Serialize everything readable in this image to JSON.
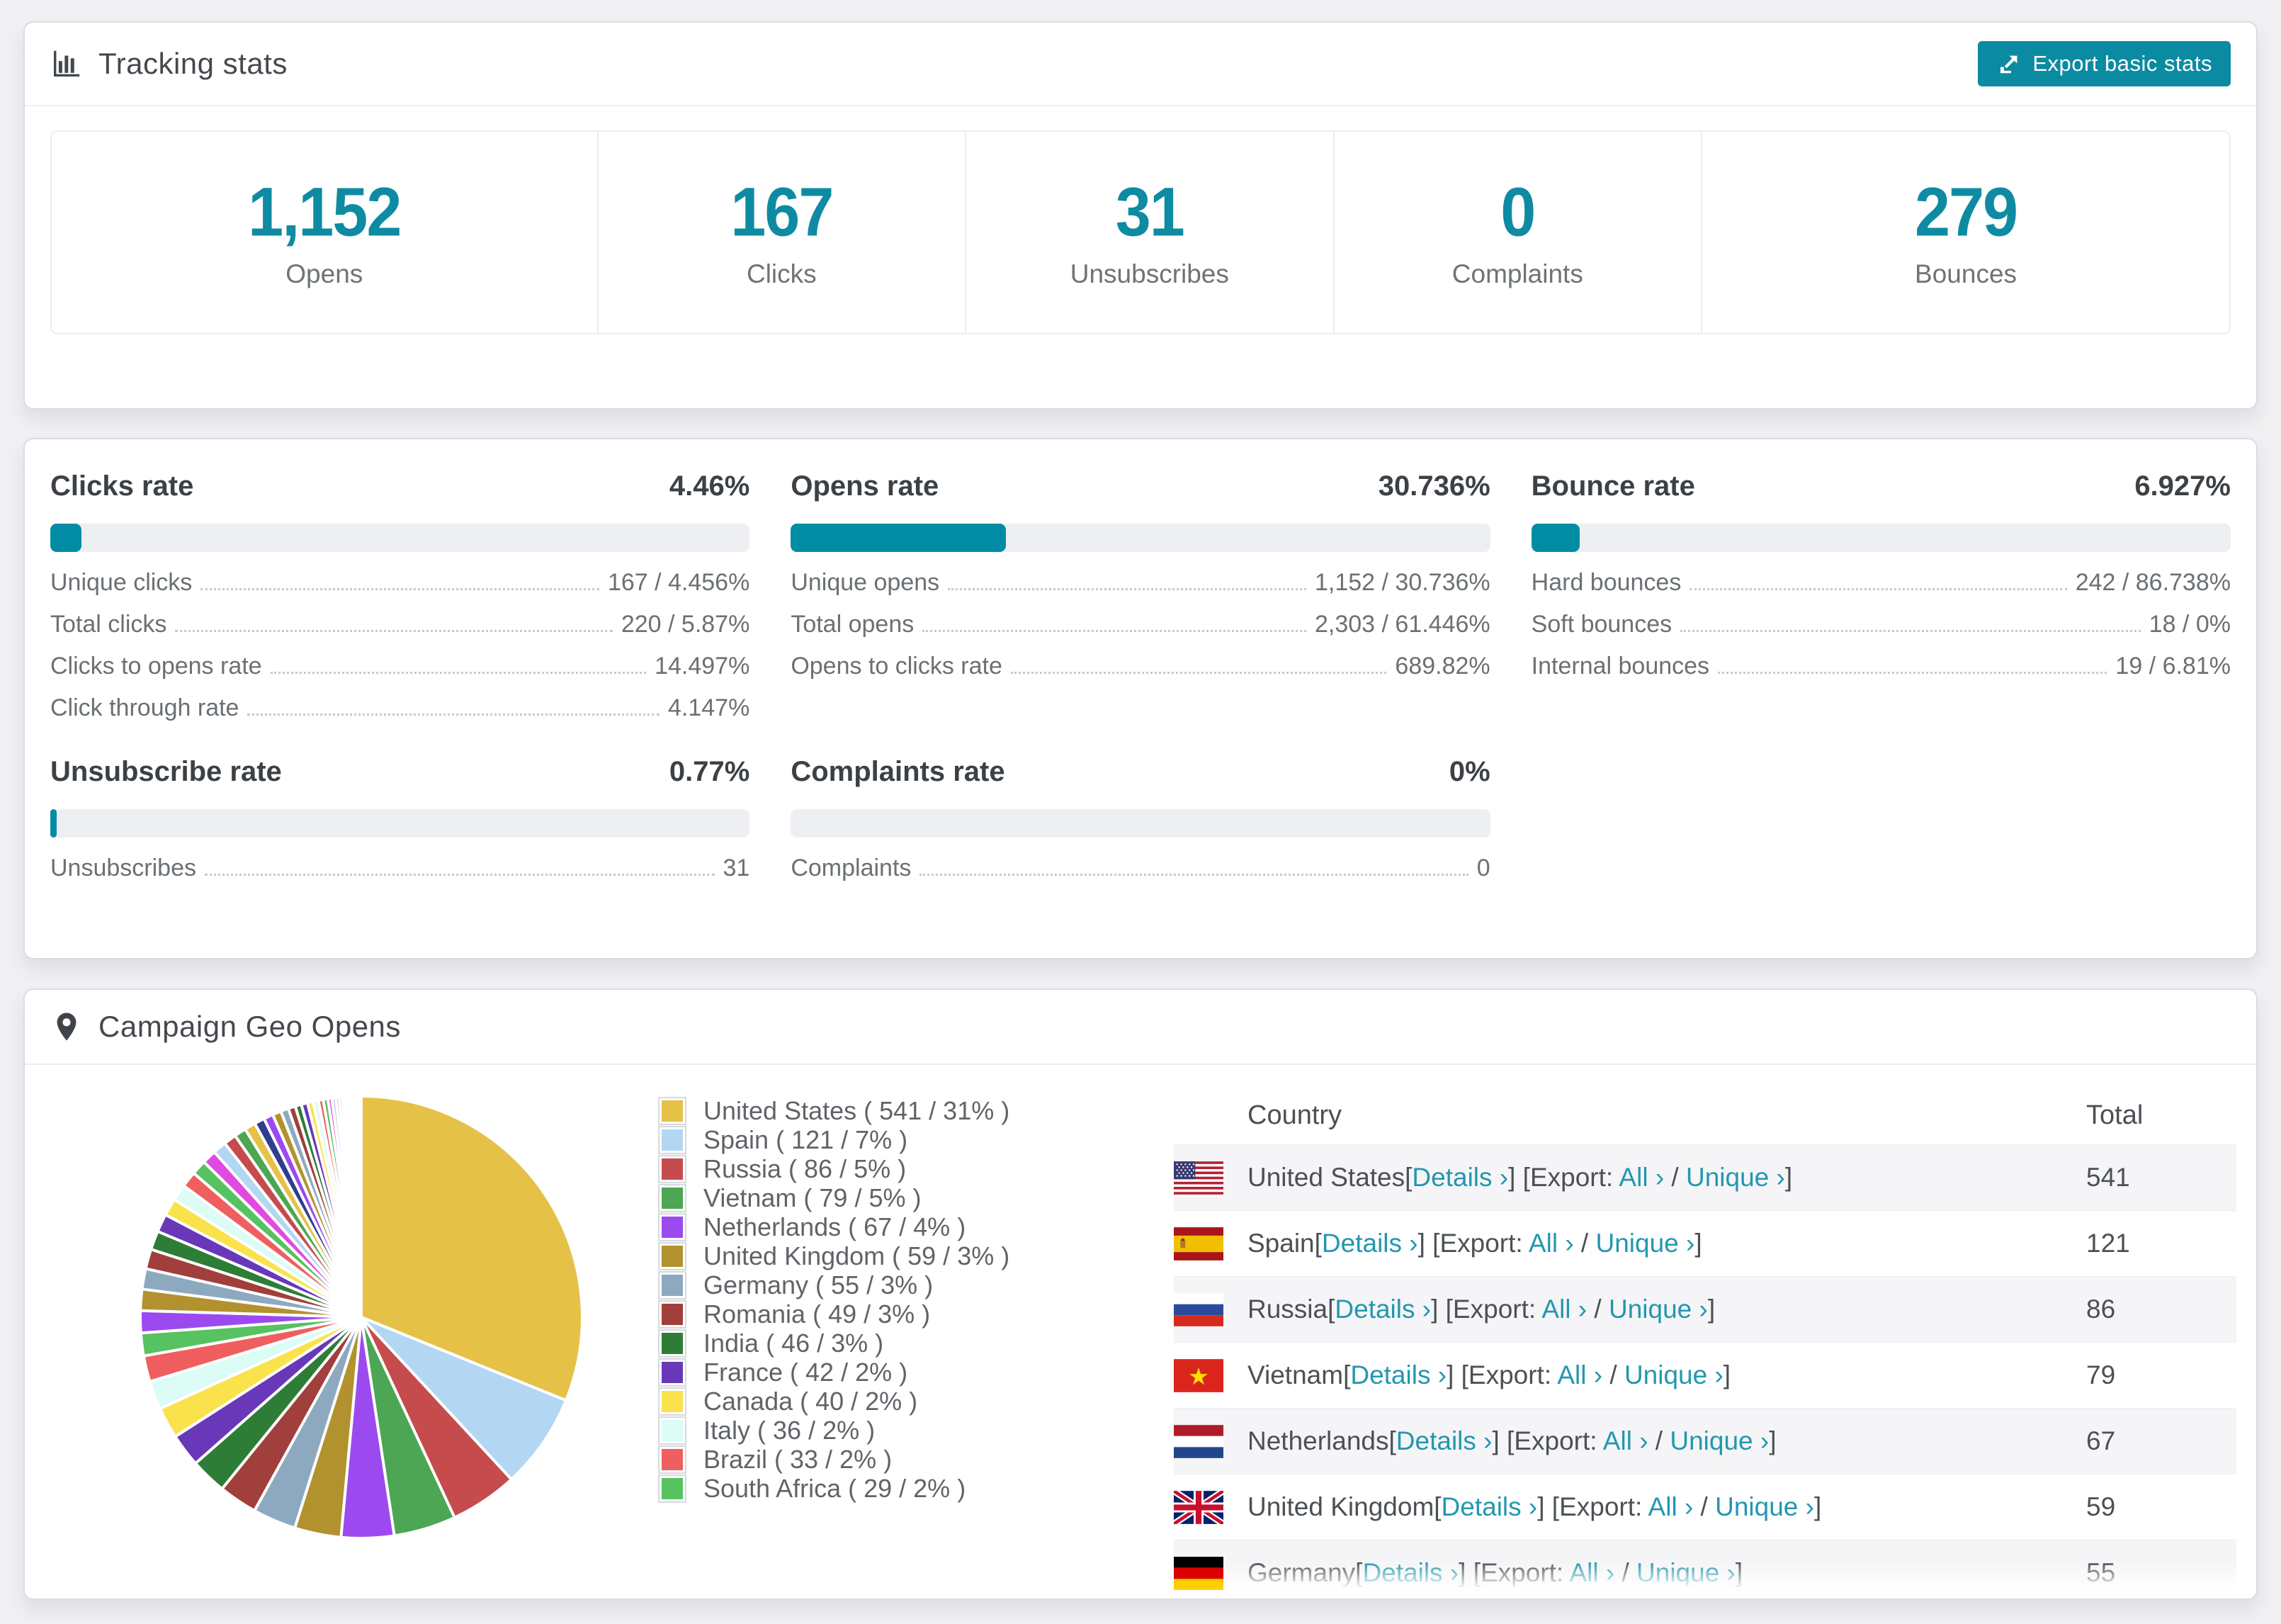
{
  "accent": {
    "teal": "#0b8ba2",
    "teal_link": "#2397af",
    "bar_fill": "#028ca4"
  },
  "tracking": {
    "title": "Tracking stats",
    "export_button": "Export basic stats",
    "stats": [
      {
        "value": "1,152",
        "label": "Opens"
      },
      {
        "value": "167",
        "label": "Clicks"
      },
      {
        "value": "31",
        "label": "Unsubscribes"
      },
      {
        "value": "0",
        "label": "Complaints"
      },
      {
        "value": "279",
        "label": "Bounces"
      }
    ]
  },
  "rates": {
    "blocks": [
      {
        "title": "Clicks rate",
        "value": "4.46%",
        "percent": 4.46,
        "rows": [
          {
            "label": "Unique clicks",
            "value": "167 / 4.456%"
          },
          {
            "label": "Total clicks",
            "value": "220 / 5.87%"
          },
          {
            "label": "Clicks to opens rate",
            "value": "14.497%"
          },
          {
            "label": "Click through rate",
            "value": "4.147%"
          }
        ]
      },
      {
        "title": "Opens rate",
        "value": "30.736%",
        "percent": 30.736,
        "rows": [
          {
            "label": "Unique opens",
            "value": "1,152 / 30.736%"
          },
          {
            "label": "Total opens",
            "value": "2,303 / 61.446%"
          },
          {
            "label": "Opens to clicks rate",
            "value": "689.82%"
          }
        ]
      },
      {
        "title": "Bounce rate",
        "value": "6.927%",
        "percent": 6.927,
        "rows": [
          {
            "label": "Hard bounces",
            "value": "242 / 86.738%"
          },
          {
            "label": "Soft bounces",
            "value": "18 / 0%"
          },
          {
            "label": "Internal bounces",
            "value": "19 / 6.81%"
          }
        ]
      },
      {
        "title": "Unsubscribe rate",
        "value": "0.77%",
        "percent": 0.77,
        "rows": [
          {
            "label": "Unsubscribes",
            "value": "31"
          }
        ]
      },
      {
        "title": "Complaints rate",
        "value": "0%",
        "percent": 0,
        "rows": [
          {
            "label": "Complaints",
            "value": "0"
          }
        ]
      }
    ]
  },
  "geo": {
    "title": "Campaign Geo Opens",
    "table": {
      "columns": [
        "Country",
        "Total"
      ],
      "labels": {
        "details": "Details ›",
        "export": "Export:",
        "all": "All ›",
        "unique": "Unique ›",
        "lb": "[",
        "rb": "]",
        "slash": "/"
      },
      "rows": [
        {
          "country": "United States",
          "flag": "us",
          "total": "541"
        },
        {
          "country": "Spain",
          "flag": "es",
          "total": "121"
        },
        {
          "country": "Russia",
          "flag": "ru",
          "total": "86"
        },
        {
          "country": "Vietnam",
          "flag": "vn",
          "total": "79"
        },
        {
          "country": "Netherlands",
          "flag": "nl",
          "total": "67"
        },
        {
          "country": "United Kingdom",
          "flag": "gb",
          "total": "59"
        },
        {
          "country": "Germany",
          "flag": "de",
          "total": "55"
        }
      ]
    }
  },
  "chart_data": {
    "type": "pie",
    "title": "Campaign Geo Opens",
    "legend_position": "right",
    "slices": [
      {
        "label": "United States",
        "value": 541,
        "pct": "31%",
        "color": "#e5c148"
      },
      {
        "label": "Spain",
        "value": 121,
        "pct": "7%",
        "color": "#b3d6f2"
      },
      {
        "label": "Russia",
        "value": 86,
        "pct": "5%",
        "color": "#c64b4d"
      },
      {
        "label": "Vietnam",
        "value": 79,
        "pct": "5%",
        "color": "#4ca653"
      },
      {
        "label": "Netherlands",
        "value": 67,
        "pct": "4%",
        "color": "#9b4af0"
      },
      {
        "label": "United Kingdom",
        "value": 59,
        "pct": "3%",
        "color": "#b2922f"
      },
      {
        "label": "Germany",
        "value": 55,
        "pct": "3%",
        "color": "#8ca9c0"
      },
      {
        "label": "Romania",
        "value": 49,
        "pct": "3%",
        "color": "#a03f3b"
      },
      {
        "label": "India",
        "value": 46,
        "pct": "3%",
        "color": "#2e7d36"
      },
      {
        "label": "France",
        "value": 42,
        "pct": "2%",
        "color": "#6838b8"
      },
      {
        "label": "Canada",
        "value": 40,
        "pct": "2%",
        "color": "#fae24c"
      },
      {
        "label": "Italy",
        "value": 36,
        "pct": "2%",
        "color": "#dcfcf6"
      },
      {
        "label": "Brazil",
        "value": 33,
        "pct": "2%",
        "color": "#f05f5f"
      },
      {
        "label": "South Africa",
        "value": 29,
        "pct": "2%",
        "color": "#56c260"
      }
    ],
    "others_values": [
      28,
      27,
      26,
      25,
      24,
      23,
      22,
      21,
      20,
      19,
      18,
      17,
      16,
      15,
      14,
      13,
      12,
      11,
      10,
      9,
      8,
      8,
      7,
      7,
      6,
      6,
      5,
      5,
      4,
      4,
      3,
      3,
      3,
      2,
      2,
      2,
      2,
      1,
      1,
      1,
      1,
      1,
      1,
      1
    ],
    "tail_palette": [
      "#9b4af0",
      "#b2922f",
      "#8ca9c0",
      "#a03f3b",
      "#2e7d36",
      "#6838b8",
      "#fae24c",
      "#dcfcf6",
      "#f05f5f",
      "#56c260",
      "#e14ae1",
      "#b3d6f2",
      "#c64b4d",
      "#4ca653",
      "#e5c148",
      "#2f3e8f"
    ]
  }
}
